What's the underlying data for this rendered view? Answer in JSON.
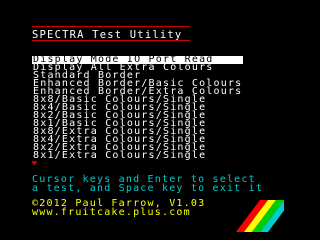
{
  "title": "SPECTRA Test Utility",
  "menu": {
    "items": [
      "Display Mode IO Port Read",
      "Display All Extra Colours",
      "Standard Border",
      "Enhanced Border/Basic Colours",
      "Enhanced Border/Extra Colours",
      "8x8/Basic Colours/Single",
      "8x4/Basic Colours/Single",
      "8x2/Basic Colours/Single",
      "8x1/Basic Colours/Single",
      "8x8/Extra Colours/Single",
      "8x4/Extra Colours/Single",
      "8x2/Extra Colours/Single",
      "8x1/Extra Colours/Single"
    ],
    "selected_index": 0,
    "more_indicator": "♥"
  },
  "help": {
    "line1": "Cursor keys and Enter to select",
    "line2": "a test, and Space key to exit it"
  },
  "footer": {
    "copyright": "©2012 Paul Farrow, V1.03",
    "url": "www.fruitcake.plus.com"
  },
  "colors": {
    "background": "#000000",
    "title": "#ffffff",
    "rule": "#d00000",
    "menu_text": "#ffffff",
    "selected_bg": "#ffffff",
    "selected_text": "#000000",
    "help_text": "#00cccc",
    "footer_text": "#ffff00",
    "stripes": [
      "#ff0000",
      "#ffff00",
      "#00cc00",
      "#00cccc"
    ]
  }
}
